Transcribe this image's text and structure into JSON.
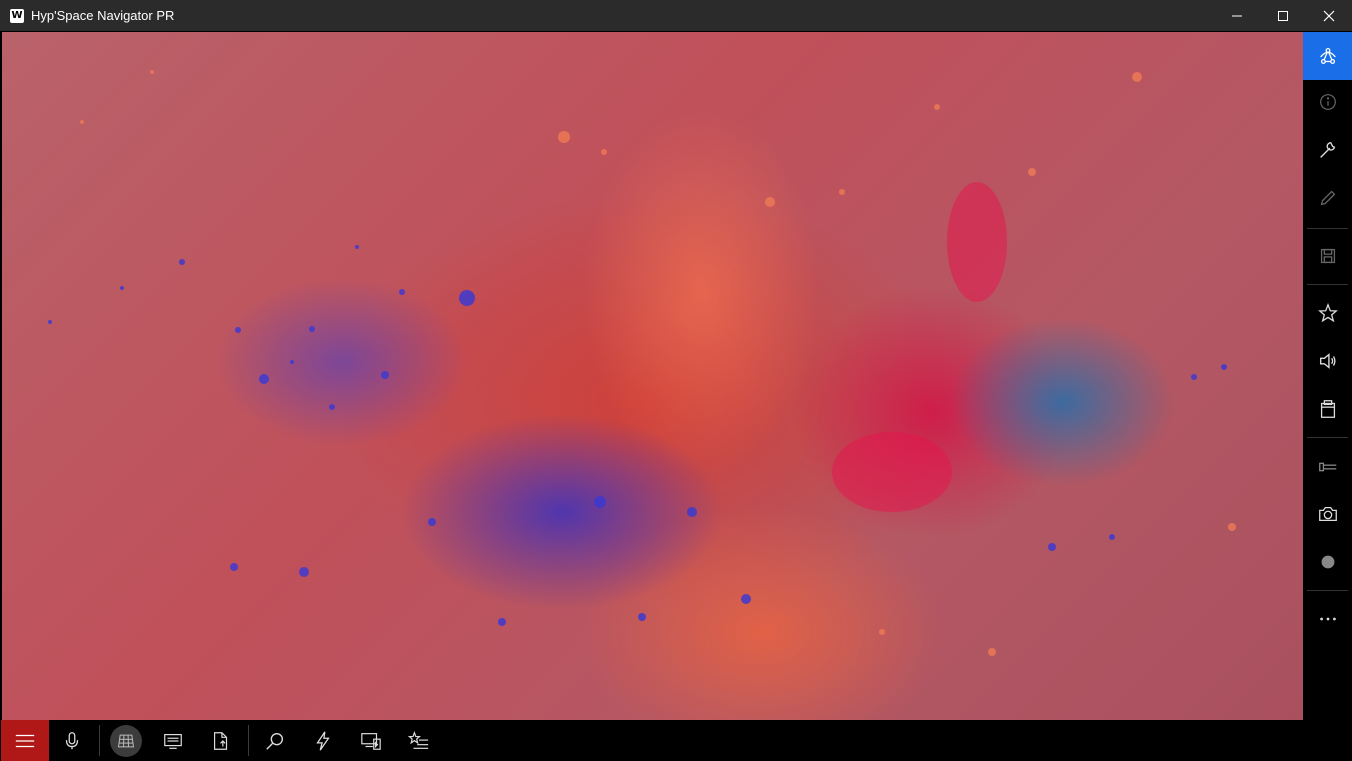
{
  "window": {
    "title": "Hyp'Space Navigator PR",
    "logo_letter": "W"
  },
  "window_controls": [
    "minimize-icon",
    "maximize-icon",
    "close-icon"
  ],
  "sidebar": {
    "accent_color": "#1a6fe8",
    "items": [
      {
        "name": "network-icon",
        "active": true
      },
      {
        "name": "info-icon",
        "active": false
      },
      {
        "name": "wrench-icon",
        "active": false
      },
      {
        "name": "pencil-icon",
        "active": false
      },
      {
        "name": "save-icon",
        "active": false
      },
      {
        "name": "star-icon",
        "active": false
      },
      {
        "name": "volume-icon",
        "active": false
      },
      {
        "name": "clipboard-icon",
        "active": false
      },
      {
        "name": "slider-icon",
        "active": false
      },
      {
        "name": "camera-icon",
        "active": false
      },
      {
        "name": "record-icon",
        "active": false
      },
      {
        "name": "more-icon",
        "active": false
      }
    ]
  },
  "toolbar": {
    "menu_color": "#b01818",
    "items": [
      {
        "name": "hamburger-menu-icon"
      },
      {
        "name": "microphone-icon"
      },
      {
        "name": "grid-icon",
        "selected": true
      },
      {
        "name": "keyboard-icon"
      },
      {
        "name": "share-file-icon"
      },
      {
        "name": "search-icon"
      },
      {
        "name": "lightning-icon"
      },
      {
        "name": "devices-icon"
      },
      {
        "name": "favorites-list-icon"
      }
    ]
  },
  "canvas": {
    "description_colors": [
      "#c0505a",
      "#3c32be",
      "#d21446",
      "#f06e50",
      "#286eaa"
    ]
  }
}
